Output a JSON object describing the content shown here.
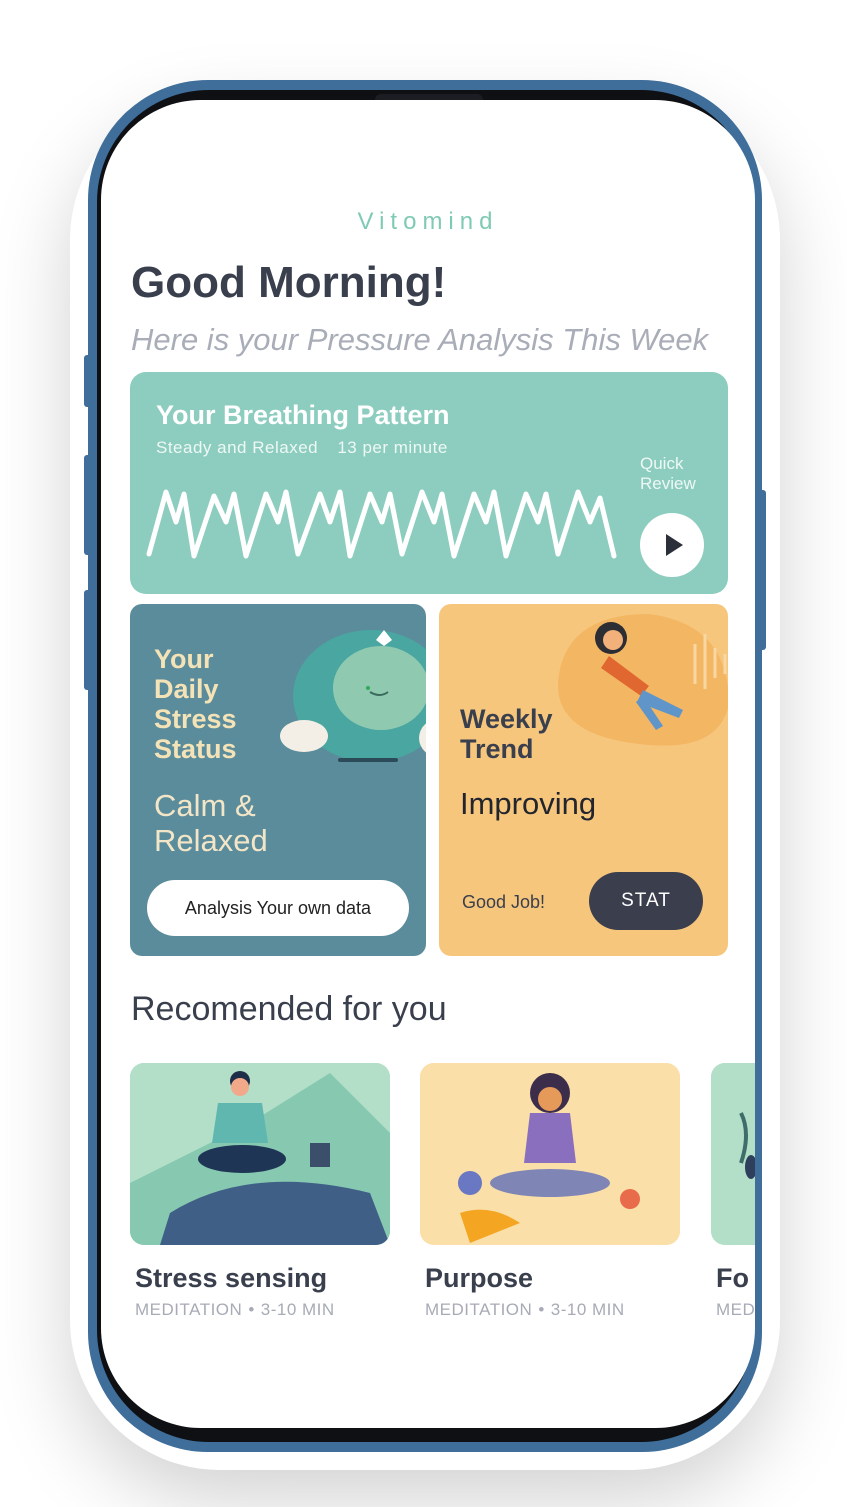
{
  "app": {
    "brand": "Vitomind"
  },
  "header": {
    "greeting": "Good Morning!",
    "subtitle": "Here is your Pressure Analysis This Week"
  },
  "breathing": {
    "title": "Your Breathing Pattern",
    "state": "Steady and Relaxed",
    "rate": "13 per minute",
    "quick_review": "Quick Review",
    "play_icon": "play-icon"
  },
  "stress": {
    "title": "Your Daily Stress Status",
    "status": "Calm & Relaxed",
    "button": "Analysis Your own data"
  },
  "trend": {
    "title": "Weekly Trend",
    "status": "Improving",
    "note": "Good Job!",
    "button": "STAT"
  },
  "recommended": {
    "title": "Recomended for you",
    "cards": [
      {
        "name": "Stress sensing",
        "category": "MEDITATION",
        "duration": "3-10 MIN"
      },
      {
        "name": "Purpose",
        "category": "MEDITATION",
        "duration": "3-10 MIN"
      },
      {
        "name": "Fo",
        "category": "MED",
        "duration": ""
      }
    ]
  },
  "colors": {
    "frame": "#3f6e9a",
    "brand": "#7fcab5",
    "breathing_card": "#8dcdbf",
    "stress_card": "#5b8c9b",
    "trend_card": "#f7c67d",
    "dark_button": "#3b3f4d"
  }
}
